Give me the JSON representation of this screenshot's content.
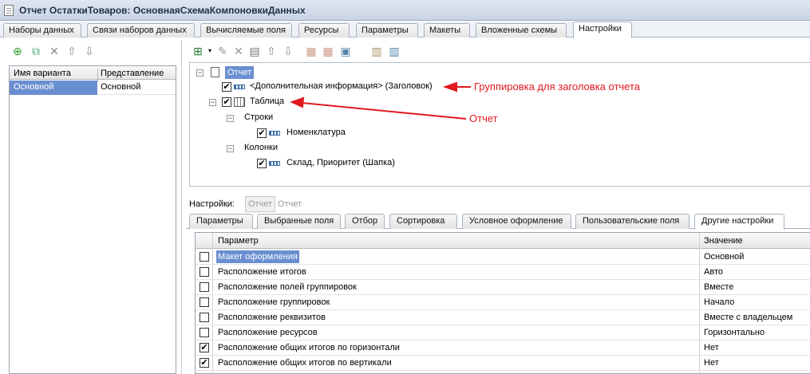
{
  "window": {
    "title": "Отчет ОстаткиТоваров: ОсновнаяСхемаКомпоновкиДанных"
  },
  "top_tabs": [
    {
      "label": "Наборы данных"
    },
    {
      "label": "Связи наборов данных"
    },
    {
      "label": "Вычисляемые поля"
    },
    {
      "label": "Ресурсы"
    },
    {
      "label": "Параметры"
    },
    {
      "label": "Макеты"
    },
    {
      "label": "Вложенные схемы"
    },
    {
      "label": "Настройки",
      "active": true
    }
  ],
  "left_toolbar": {
    "icons": [
      "add-icon",
      "copy-icon",
      "delete-icon",
      "move-up-icon",
      "move-down-icon"
    ]
  },
  "variants": {
    "columns": [
      "Имя варианта",
      "Представление"
    ],
    "rows": [
      {
        "name": "Основной",
        "presentation": "Основной"
      }
    ]
  },
  "structure_toolbar": {
    "icons": [
      "add-group-icon",
      "edit-icon",
      "delete-icon",
      "properties-icon",
      "move-up-icon",
      "move-down-icon",
      "settings-icon",
      "settings-group-icon",
      "settings-report-icon",
      "table-view-icon",
      "chart-view-icon"
    ]
  },
  "structure": {
    "root": "Отчет",
    "header_group": "<Дополнительная информация> (Заголовок)",
    "table": "Таблица",
    "rows_label": "Строки",
    "rows_item": "Номенклатура",
    "columns_label": "Колонки",
    "columns_item": "Склад, Приоритет (Шапка)"
  },
  "annotations": {
    "group_header": "Группировка для заголовка отчета",
    "report": "Отчет",
    "color": "#e0191f"
  },
  "settings": {
    "label": "Настройки:",
    "button": "Отчет",
    "link": "Отчет"
  },
  "settings_tabs": [
    {
      "label": "Параметры"
    },
    {
      "label": "Выбранные поля"
    },
    {
      "label": "Отбор"
    },
    {
      "label": "Сортировка"
    },
    {
      "label": "Условное оформление"
    },
    {
      "label": "Пользовательские поля"
    },
    {
      "label": "Другие настройки",
      "active": true
    }
  ],
  "params_table": {
    "columns": [
      "Параметр",
      "Значение"
    ],
    "rows": [
      {
        "param": "Макет оформления",
        "value": "Основной",
        "checked": false,
        "selected": true
      },
      {
        "param": "Расположение итогов",
        "value": "Авто",
        "checked": false
      },
      {
        "param": "Расположение полей группировок",
        "value": "Вместе",
        "checked": false
      },
      {
        "param": "Расположение группировок",
        "value": "Начало",
        "checked": false
      },
      {
        "param": "Расположение реквизитов",
        "value": "Вместе с владельцем",
        "checked": false
      },
      {
        "param": "Расположение ресурсов",
        "value": "Горизонтально",
        "checked": false
      },
      {
        "param": "Расположение общих итогов по горизонтали",
        "value": "Нет",
        "checked": true
      },
      {
        "param": "Расположение общих итогов по вертикали",
        "value": "Нет",
        "checked": true
      }
    ]
  }
}
